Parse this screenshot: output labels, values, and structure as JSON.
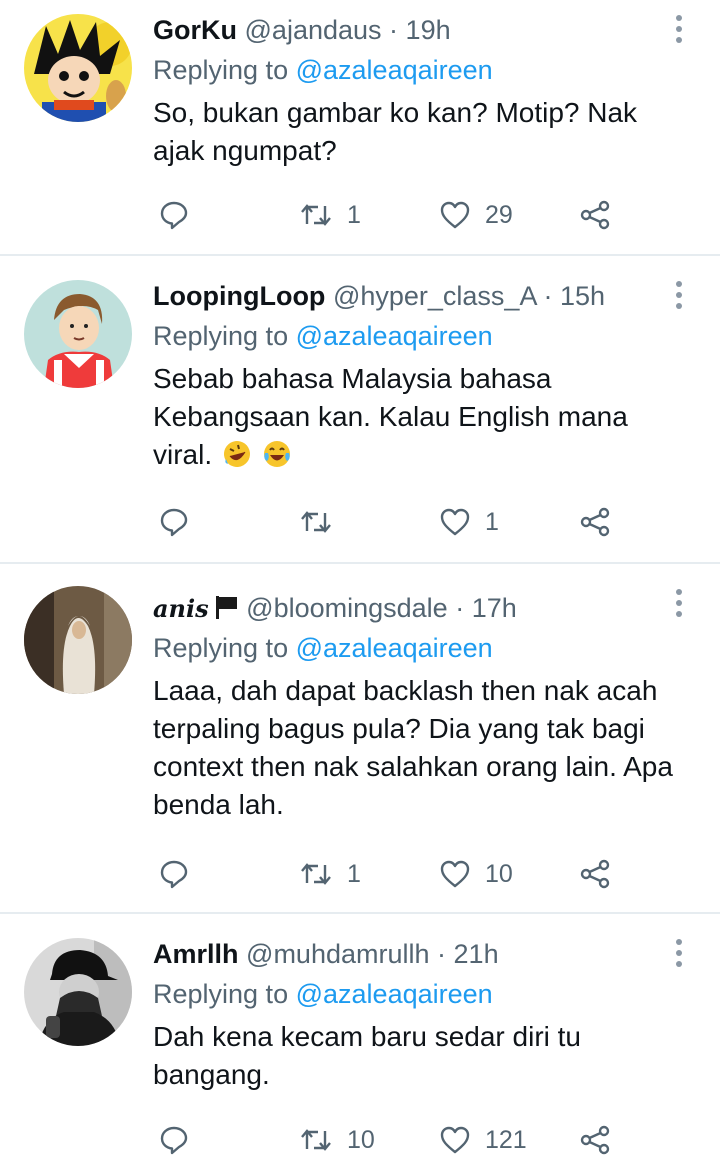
{
  "replying_label": "Replying to",
  "replies": [
    {
      "display_name": "GorKu",
      "handle": "@ajandaus",
      "time": "19h",
      "replying_to": "@azaleaqaireen",
      "text": "So, bukan gambar ko kan? Motip? Nak ajak ngumpat?",
      "retweets": "1",
      "likes": "29",
      "avatar": "cartoon-boy-avatar"
    },
    {
      "display_name": "LoopingLoop",
      "handle": "@hyper_class_A",
      "time": "15h",
      "replying_to": "@azaleaqaireen",
      "text": "Sebab bahasa Malaysia bahasa Kebangsaan kan. Kalau English mana viral.",
      "emojis": [
        "rolling-on-floor-laughing-emoji",
        "tears-of-joy-emoji"
      ],
      "retweets": "",
      "likes": "1",
      "avatar": "football-jersey-avatar"
    },
    {
      "display_name": "anis",
      "handle": "@bloomingsdale",
      "time": "17h",
      "replying_to": "@azaleaqaireen",
      "text": "Laaa, dah dapat backlash then nak acah terpaling bagus pula? Dia yang tak bagi context then nak salahkan orang lain. Apa benda lah.",
      "retweets": "1",
      "likes": "10",
      "avatar": "veiled-woman-avatar",
      "name_icon": "black-flag-icon"
    },
    {
      "display_name": "Amrllh",
      "handle": "@muhdamrullh",
      "time": "21h",
      "replying_to": "@azaleaqaireen",
      "text": "Dah kena kecam baru sedar diri tu bangang.",
      "retweets": "10",
      "likes": "121",
      "avatar": "man-with-cap-avatar"
    }
  ],
  "colors": {
    "mention": "#1d9bf0",
    "secondary_text": "#536471",
    "primary_text": "#0f1419",
    "divider": "#e6ecf0"
  }
}
